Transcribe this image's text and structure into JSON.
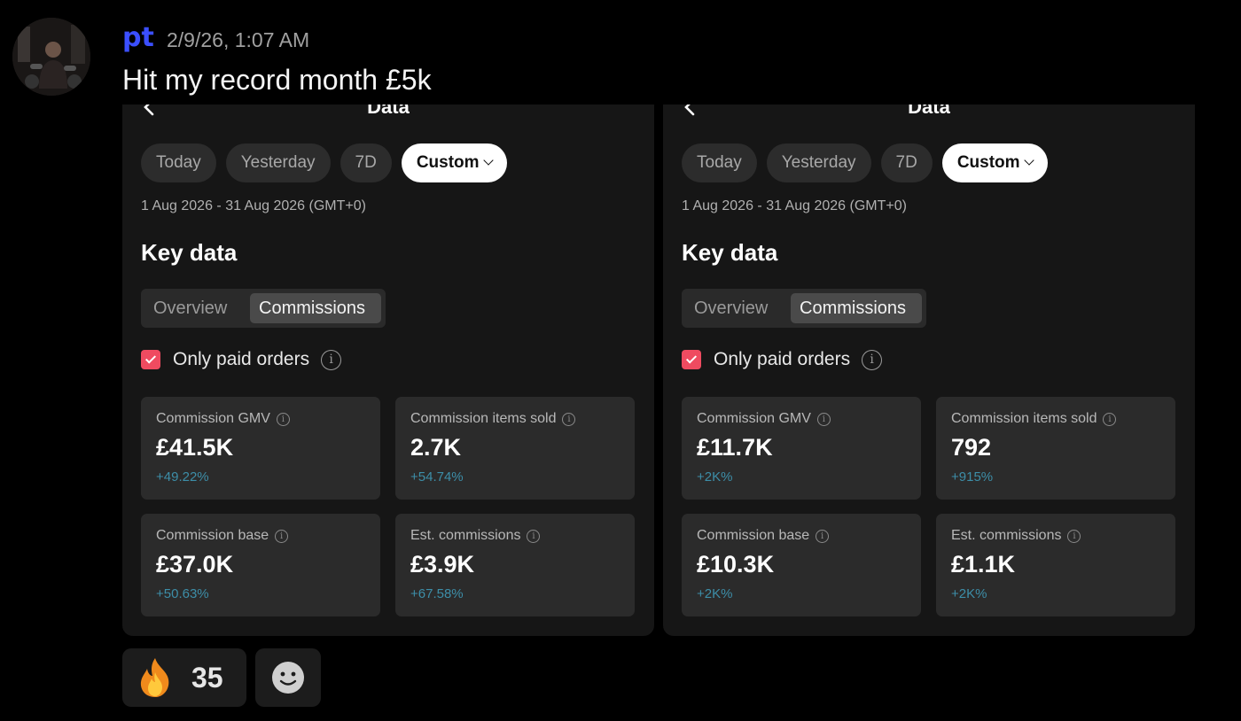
{
  "message": {
    "username": "pt",
    "timestamp": "2/9/26, 1:07 AM",
    "text": "Hit my record month £5k"
  },
  "screenshots": [
    {
      "nav_title": "Data",
      "pills": [
        "Today",
        "Yesterday",
        "7D",
        "Custom"
      ],
      "active_pill": "Custom",
      "date_range": "1 Aug 2026 - 31 Aug 2026 (GMT+0)",
      "section_title": "Key data",
      "segments": [
        "Overview",
        "Commissions"
      ],
      "active_segment": "Commissions",
      "paid_label": "Only paid orders",
      "paid_checked": true,
      "cards": [
        {
          "label": "Commission GMV",
          "value": "£41.5K",
          "change": "+49.22%"
        },
        {
          "label": "Commission items sold",
          "value": "2.7K",
          "change": "+54.74%"
        },
        {
          "label": "Commission base",
          "value": "£37.0K",
          "change": "+50.63%"
        },
        {
          "label": "Est. commissions",
          "value": "£3.9K",
          "change": "+67.58%"
        }
      ]
    },
    {
      "nav_title": "Data",
      "pills": [
        "Today",
        "Yesterday",
        "7D",
        "Custom"
      ],
      "active_pill": "Custom",
      "date_range": "1 Aug 2026 - 31 Aug 2026 (GMT+0)",
      "section_title": "Key data",
      "segments": [
        "Overview",
        "Commissions"
      ],
      "active_segment": "Commissions",
      "paid_label": "Only paid orders",
      "paid_checked": true,
      "cards": [
        {
          "label": "Commission GMV",
          "value": "£11.7K",
          "change": "+2K%"
        },
        {
          "label": "Commission items sold",
          "value": "792",
          "change": "+915%"
        },
        {
          "label": "Commission base",
          "value": "£10.3K",
          "change": "+2K%"
        },
        {
          "label": "Est. commissions",
          "value": "£1.1K",
          "change": "+2K%"
        }
      ]
    }
  ],
  "reactions": [
    {
      "icon": "fire-icon",
      "count": "35"
    },
    {
      "icon": "add-reaction-smiley-icon"
    }
  ],
  "colors": {
    "username": "#3b4fff",
    "checkbox": "#ef4b60",
    "change": "#3d8ea8",
    "card_bg": "#2b2b2b",
    "panel_bg": "#161616"
  }
}
